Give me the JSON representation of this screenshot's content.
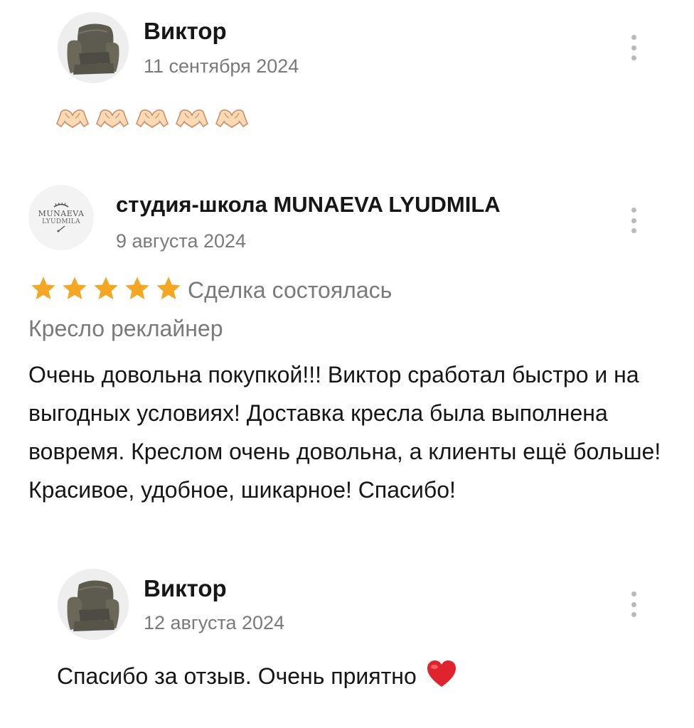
{
  "reviews": [
    {
      "author": "Виктор",
      "date": "11 сентября 2024",
      "avatar_icon": "armchair-avatar",
      "reaction_icons": [
        "heart-hands-icon",
        "heart-hands-icon",
        "heart-hands-icon",
        "heart-hands-icon",
        "heart-hands-icon"
      ]
    },
    {
      "author": "студия-школа MUNAEVA LYUDMILA",
      "date": "9 августа 2024",
      "avatar_logo": {
        "line1": "MUNAEVA",
        "line2": "LYUDMILA"
      },
      "rating": 5,
      "rating_color": "#f5a623",
      "deal_status": "Сделка состоялась",
      "item_title": "Кресло реклайнер",
      "text": "Очень довольна покупкой!!! Виктор сработал быстро и на выгодных условиях! Доставка кресла была выполнена вовремя. Креслом очень довольна, а клиенты ещё больше! Красивое, удобное, шикарное! Спасибо!"
    },
    {
      "author": "Виктор",
      "date": "12 августа 2024",
      "avatar_icon": "armchair-avatar",
      "text": "Спасибо за отзыв. Очень приятно",
      "trailing_icon": "red-heart-icon"
    }
  ],
  "colors": {
    "name": "#161616",
    "secondary_text": "#7a7a7a",
    "kebab": "#b9b9b9",
    "star": "#f5a623",
    "heart": "#e0242e"
  }
}
